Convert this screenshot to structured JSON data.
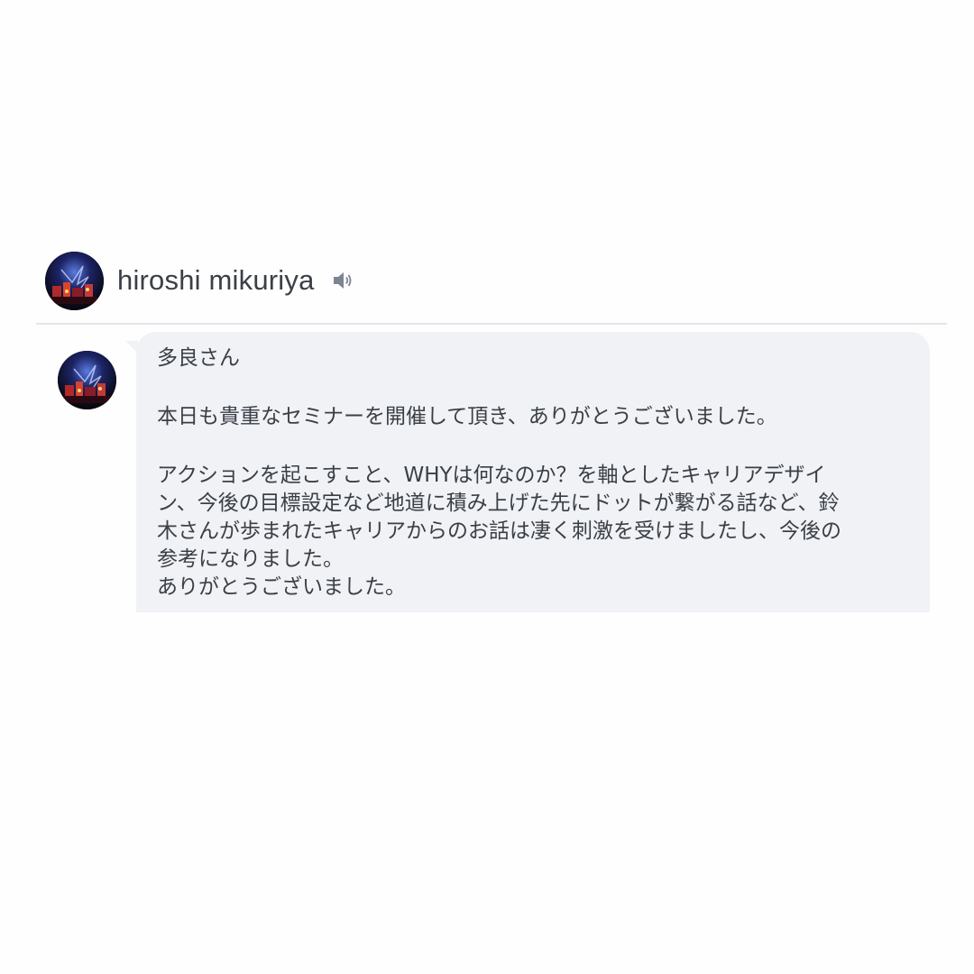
{
  "header": {
    "sender_name": "hiroshi mikuriya",
    "speaker_icon": "speaker-icon",
    "avatar_icon": "avatar-photo"
  },
  "message": {
    "greeting": "多良さん",
    "paragraph1": "本日も貴重なセミナーを開催して頂き、ありがとうございました。",
    "paragraph2_lines": [
      "アクションを起こすこと、WHYは何なのか？を軸としたキャリアデザイ",
      "ン、今後の目標設定など地道に積み上げた先にドットが繋がる話など、鈴",
      "木さんが歩まれたキャリアからのお話は凄く刺激を受けましたし、今後の",
      "参考になりました。",
      "ありがとうございました。"
    ]
  },
  "colors": {
    "bubble": "#f0f2f5",
    "text": "#3a3f47",
    "divider": "#e3e5e8"
  }
}
